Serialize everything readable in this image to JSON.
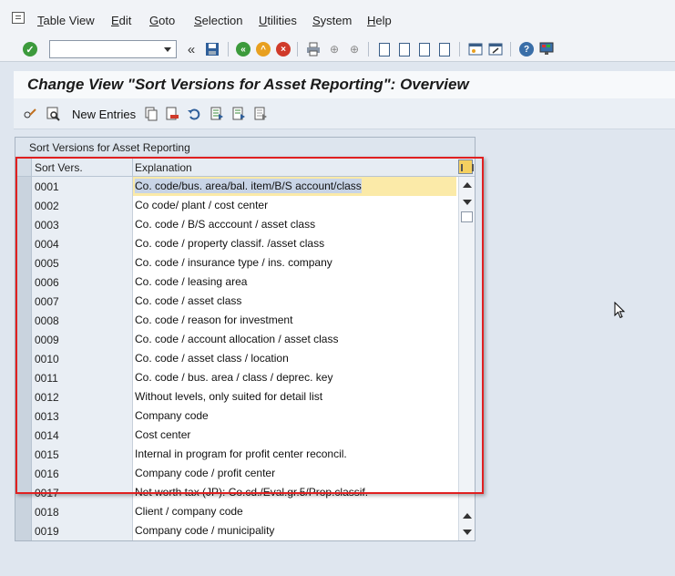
{
  "menu": {
    "items": [
      "Table View",
      "Edit",
      "Goto",
      "Selection",
      "Utilities",
      "System",
      "Help"
    ]
  },
  "toolbar": {
    "command_field_value": ""
  },
  "title": "Change View \"Sort Versions for Asset Reporting\": Overview",
  "app_toolbar": {
    "new_entries_label": "New Entries"
  },
  "table": {
    "title": "Sort Versions for Asset Reporting",
    "columns": [
      "Sort Vers.",
      "Explanation"
    ],
    "rows": [
      {
        "sort": "0001",
        "explanation": "Co. code/bus. area/bal. item/B/S account/class"
      },
      {
        "sort": "0002",
        "explanation": "Co code/ plant / cost center"
      },
      {
        "sort": "0003",
        "explanation": "Co. code / B/S acccount / asset class"
      },
      {
        "sort": "0004",
        "explanation": "Co. code / property classif. /asset class"
      },
      {
        "sort": "0005",
        "explanation": "Co. code / insurance type / ins. company"
      },
      {
        "sort": "0006",
        "explanation": "Co. code / leasing area"
      },
      {
        "sort": "0007",
        "explanation": "Co. code / asset class"
      },
      {
        "sort": "0008",
        "explanation": "Co. code / reason for investment"
      },
      {
        "sort": "0009",
        "explanation": "Co. code / account allocation / asset class"
      },
      {
        "sort": "0010",
        "explanation": "Co. code / asset class / location"
      },
      {
        "sort": "0011",
        "explanation": "Co. code / bus. area / class / deprec. key"
      },
      {
        "sort": "0012",
        "explanation": "Without levels, only suited for detail list"
      },
      {
        "sort": "0013",
        "explanation": "Company code"
      },
      {
        "sort": "0014",
        "explanation": "Cost center"
      },
      {
        "sort": "0015",
        "explanation": "Internal in program for profit center reconcil."
      },
      {
        "sort": "0016",
        "explanation": "Company code / profit center"
      },
      {
        "sort": "0017",
        "explanation": "Net worth tax (JP): Co.cd./Eval.gr.5/Prop.classif."
      },
      {
        "sort": "0018",
        "explanation": "Client / company code"
      },
      {
        "sort": "0019",
        "explanation": "Company code / municipality"
      }
    ]
  },
  "colors": {
    "highlight_border": "#e02020",
    "active_cell": "#fbeaa8"
  }
}
